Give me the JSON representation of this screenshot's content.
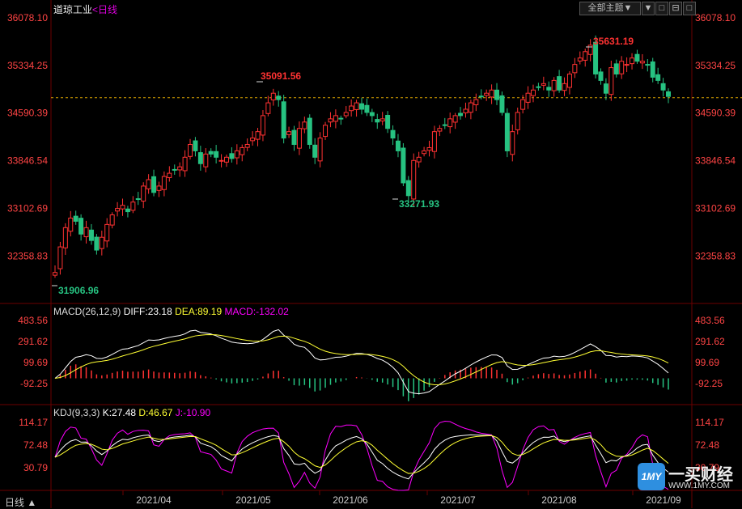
{
  "header": {
    "name": "道琼工业",
    "period_prefix": "<",
    "period": "日线",
    "theme_button": "全部主题▼",
    "nav_buttons": [
      "▼",
      "□",
      "⊟",
      "□"
    ]
  },
  "period_selector": "日线 ▲",
  "price_axis": {
    "ticks": [
      "36078.10",
      "35334.25",
      "34590.39",
      "33846.54",
      "33102.69",
      "32358.83"
    ],
    "values": [
      36078.1,
      35334.25,
      34590.39,
      33846.54,
      33102.69,
      32358.83
    ],
    "reference_line": 34830
  },
  "annotations": {
    "high_1": "35091.56",
    "high_2": "35631.19",
    "low_1": "31906.96",
    "low_2": "33271.93"
  },
  "macd": {
    "title": "MACD(26,12,9)",
    "diff_label": "DIFF:23.18",
    "dea_label": "DEA:89.19",
    "macd_label": "MACD:-132.02",
    "ticks": [
      "483.56",
      "291.62",
      "99.69",
      "-92.25"
    ],
    "values": [
      483.56,
      291.62,
      99.69,
      -92.25
    ]
  },
  "kdj": {
    "title": "KDJ(9,3,3)",
    "k_label": "K:27.48",
    "d_label": "D:46.67",
    "j_label": "J:-10.90",
    "ticks": [
      "114.17",
      "72.48",
      "30.79"
    ],
    "values": [
      114.17,
      72.48,
      30.79
    ]
  },
  "x_axis": {
    "months": [
      "2021/04",
      "2021/05",
      "2021/06",
      "2021/07",
      "2021/08",
      "2021/09"
    ]
  },
  "colors": {
    "up": "#ff3232",
    "down": "#26c281",
    "macd_diff": "#ffffff",
    "macd_dea": "#ffff33",
    "macd_hist": "#ff00ff",
    "kdj_k": "#ffffff",
    "kdj_d": "#ffff33",
    "kdj_j": "#ff00ff",
    "axis_text": "#ff4444",
    "grid": "#6b0000"
  },
  "watermark": {
    "icon": "1MY",
    "name": "一买财经",
    "url": "WWW.1MY.COM"
  },
  "chart_data": {
    "type": "candlestick",
    "title": "道琼工业 日线",
    "x_months": [
      "2021/04",
      "2021/05",
      "2021/06",
      "2021/07",
      "2021/08",
      "2021/09"
    ],
    "ylim": [
      31906.96,
      36078.1
    ],
    "closes_approx": [
      32100,
      32500,
      32800,
      32950,
      32900,
      32700,
      32800,
      32600,
      32450,
      32650,
      32850,
      33000,
      33100,
      33150,
      33050,
      33200,
      33250,
      33450,
      33550,
      33350,
      33450,
      33600,
      33650,
      33700,
      33750,
      33900,
      34100,
      34000,
      33800,
      33950,
      33950,
      33900,
      33850,
      33900,
      33880,
      34000,
      34050,
      34100,
      34200,
      34300,
      34550,
      34750,
      34900,
      34800,
      34200,
      34300,
      34100,
      34350,
      34450,
      34100,
      33900,
      34200,
      34400,
      34500,
      34550,
      34500,
      34600,
      34700,
      34750,
      34650,
      34600,
      34550,
      34450,
      34500,
      34350,
      34200,
      34000,
      33500,
      33300,
      33850,
      33900,
      34000,
      34050,
      34300,
      34350,
      34400,
      34500,
      34550,
      34550,
      34650,
      34750,
      34800,
      34850,
      34900,
      34950,
      34800,
      34600,
      34000,
      34300,
      34600,
      34800,
      34900,
      34950,
      35000,
      35050,
      34950,
      35100,
      34950,
      35050,
      35200,
      35350,
      35450,
      35550,
      35650,
      35200,
      35100,
      34900,
      35300,
      35200,
      35400,
      35350,
      35450,
      35400,
      35400,
      35350,
      35150,
      35100,
      34950,
      34850
    ]
  }
}
